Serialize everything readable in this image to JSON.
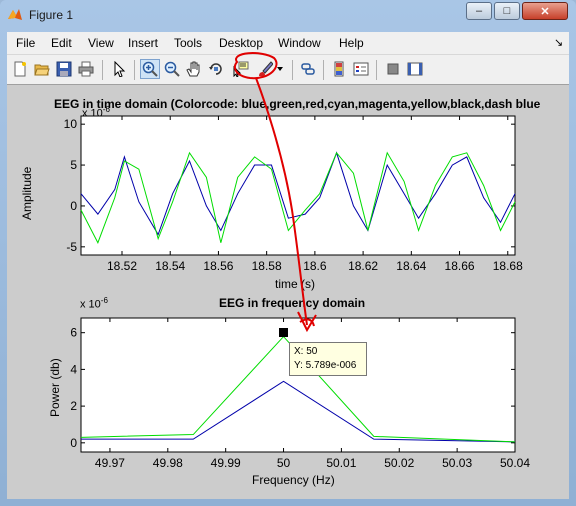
{
  "window": {
    "title": "Figure 1",
    "buttons": [
      "–",
      "□",
      "✕"
    ]
  },
  "menu": {
    "items": [
      "File",
      "Edit",
      "View",
      "Insert",
      "Tools",
      "Desktop",
      "Window",
      "Help"
    ],
    "dock_arrow": "↘"
  },
  "toolbar": {
    "icons": [
      "new-figure",
      "open-file",
      "save",
      "print",
      "edit-plot",
      "zoom-in",
      "zoom-out",
      "pan",
      "rotate-3d",
      "data-cursor",
      "brush",
      "link-plot",
      "colorbar",
      "legend",
      "hide-plot-tools",
      "show-plot-tools"
    ]
  },
  "accent_colors": {
    "series1": "#0000aa",
    "series2": "#00dd00",
    "annotation": "#e00000"
  },
  "plots": {
    "top": {
      "title": "EEG in time domain (Colorcode: blue,green,red,cyan,magenta,yellow,black,dash blue",
      "xlabel": "time (s)",
      "ylabel": "Amplitude",
      "exponent_base": "x 10",
      "exponent_power": "-6",
      "xticks": [
        "18.52",
        "18.54",
        "18.56",
        "18.58",
        "18.6",
        "18.62",
        "18.64",
        "18.66",
        "18.68"
      ],
      "yticks": [
        "10",
        "5",
        "0",
        "-5"
      ]
    },
    "bottom": {
      "title": "EEG in frequency domain",
      "xlabel": "Frequency (Hz)",
      "ylabel": "Power (db)",
      "exponent_base": "x 10",
      "exponent_power": "-6",
      "xticks": [
        "49.97",
        "49.98",
        "49.99",
        "50",
        "50.01",
        "50.02",
        "50.03",
        "50.04"
      ],
      "yticks": [
        "6",
        "4",
        "2",
        "0"
      ]
    }
  },
  "datatip": {
    "x_text": "X: 50",
    "y_text": "Y: 5.789e-006"
  },
  "chart_data": [
    {
      "type": "line",
      "title": "EEG in time domain (Colorcode: blue,green,red,cyan,magenta,yellow,black,dash blue",
      "xlabel": "time (s)",
      "ylabel": "Amplitude",
      "y_scale_note": "x 10^-6",
      "xlim": [
        18.503,
        18.683
      ],
      "ylim": [
        -6,
        11
      ],
      "grid": false,
      "x": [
        18.503,
        18.51,
        18.517,
        18.521,
        18.527,
        18.535,
        18.541,
        18.548,
        18.555,
        18.561,
        18.568,
        18.575,
        18.582,
        18.589,
        18.596,
        18.602,
        18.609,
        18.616,
        18.622,
        18.63,
        18.637,
        18.643,
        18.65,
        18.657,
        18.663,
        18.67,
        18.677,
        18.683
      ],
      "series": [
        {
          "color": "#0000aa",
          "values": [
            1.5,
            -1.0,
            2.0,
            6.0,
            0.5,
            -3.5,
            1.5,
            5.5,
            0.0,
            -3.0,
            1.5,
            5.0,
            5.0,
            -1.5,
            -1.0,
            1.0,
            6.5,
            0.0,
            -3.0,
            5.0,
            1.5,
            -1.5,
            1.5,
            5.0,
            6.0,
            1.0,
            -2.0,
            1.5
          ]
        },
        {
          "color": "#00dd00",
          "values": [
            -0.5,
            -4.5,
            1.0,
            5.5,
            4.5,
            -4.0,
            0.5,
            6.5,
            3.5,
            -4.5,
            3.5,
            6.0,
            4.5,
            -3.0,
            -0.5,
            1.5,
            6.5,
            4.0,
            -3.0,
            6.5,
            3.0,
            -3.0,
            2.5,
            6.0,
            6.5,
            2.5,
            -3.0,
            0.5
          ]
        }
      ]
    },
    {
      "type": "line",
      "title": "EEG in frequency domain",
      "xlabel": "Frequency (Hz)",
      "ylabel": "Power (db)",
      "y_scale_note": "x 10^-6",
      "xlim": [
        49.965,
        50.04
      ],
      "ylim": [
        -0.5,
        6.8
      ],
      "grid": false,
      "x": [
        49.965,
        49.9844,
        50.0,
        50.0156,
        50.04
      ],
      "series": [
        {
          "color": "#0000aa",
          "values": [
            0.2,
            0.2,
            3.35,
            0.2,
            0.05
          ]
        },
        {
          "color": "#00dd00",
          "values": [
            0.3,
            0.45,
            5.789,
            0.35,
            0.05
          ]
        }
      ]
    }
  ]
}
